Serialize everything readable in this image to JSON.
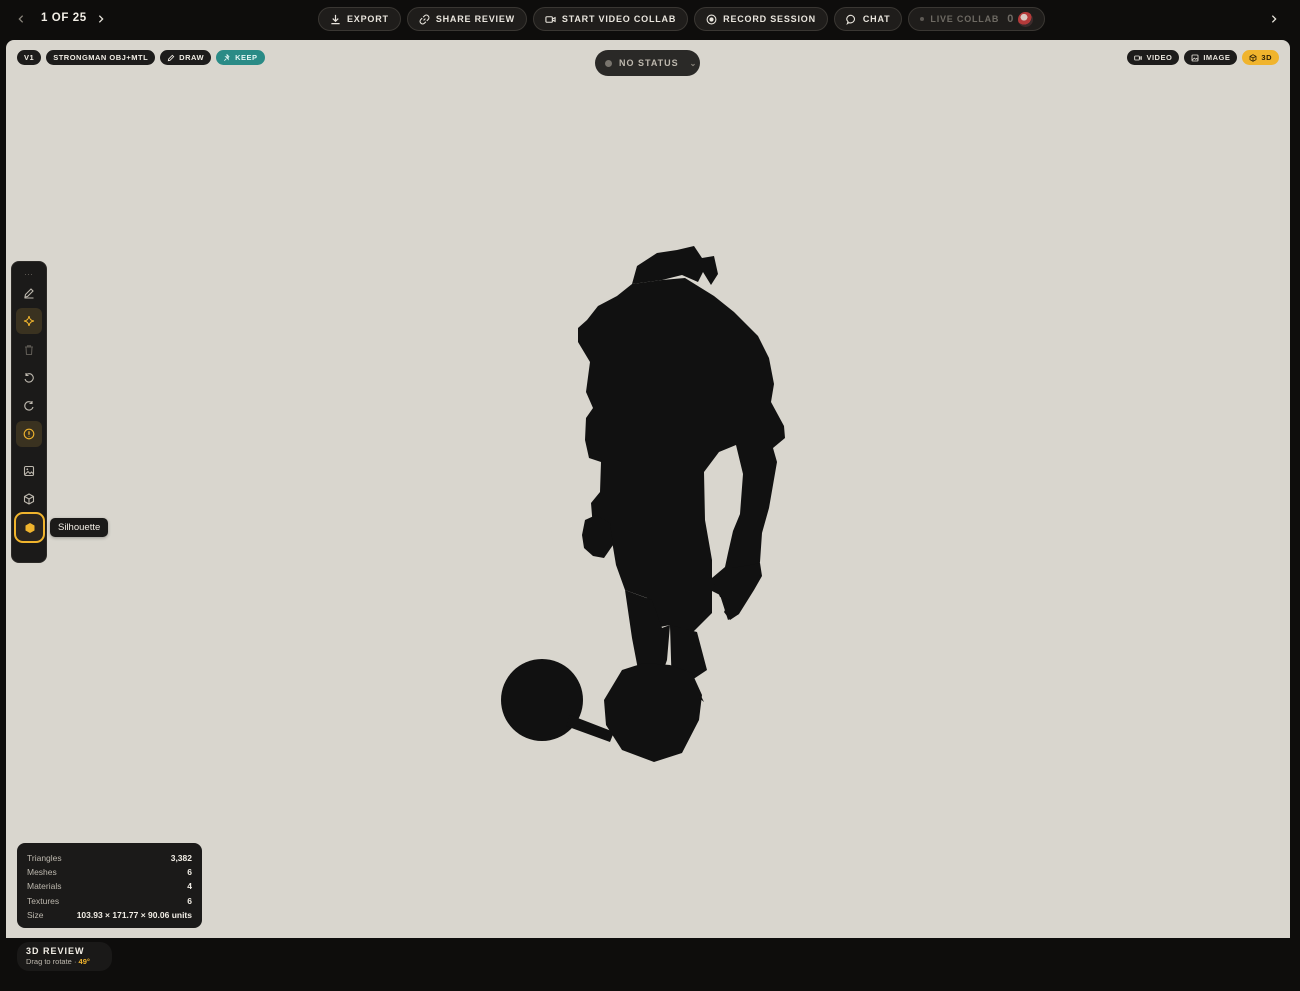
{
  "topbar": {
    "prev_icon": "chevron-left-icon",
    "counter": "1 OF 25",
    "next_icon": "chevron-right-icon",
    "export": "EXPORT",
    "share_review": "SHARE REVIEW",
    "start_video_collab": "START VIDEO COLLAB",
    "record_session": "RECORD SESSION",
    "chat": "CHAT",
    "live_collab": "LIVE COLLAB",
    "live_count": "0",
    "far_right_icon": "chevron-right-icon"
  },
  "chips": {
    "version": "V1",
    "asset": "STRONGMAN OBJ+MTL",
    "draw": "DRAW",
    "keep": "KEEP"
  },
  "status": {
    "label": "NO STATUS"
  },
  "modes": {
    "video": "VIDEO",
    "image": "IMAGE",
    "three_d": "3D",
    "active": "3D"
  },
  "tools": {
    "items": [
      "pencil-icon",
      "sparkle-icon",
      "trash-icon",
      "undo-icon",
      "redo-icon",
      "info-icon",
      "image-icon",
      "cube-icon",
      "silhouette-icon"
    ],
    "tooltip": "Silhouette"
  },
  "stats": {
    "triangles_label": "Triangles",
    "triangles": "3,382",
    "meshes_label": "Meshes",
    "meshes": "6",
    "materials_label": "Materials",
    "materials": "4",
    "textures_label": "Textures",
    "textures": "6",
    "size_label": "Size",
    "size": "103.93 × 171.77 × 90.06 units"
  },
  "review": {
    "title": "3D REVIEW",
    "hint": "Drag to rotate · ",
    "angle": "49°"
  },
  "colors": {
    "accent": "#f0b42d",
    "keep": "#2a8b86",
    "stage": "#d9d6ce",
    "silhouette": "#111111"
  }
}
